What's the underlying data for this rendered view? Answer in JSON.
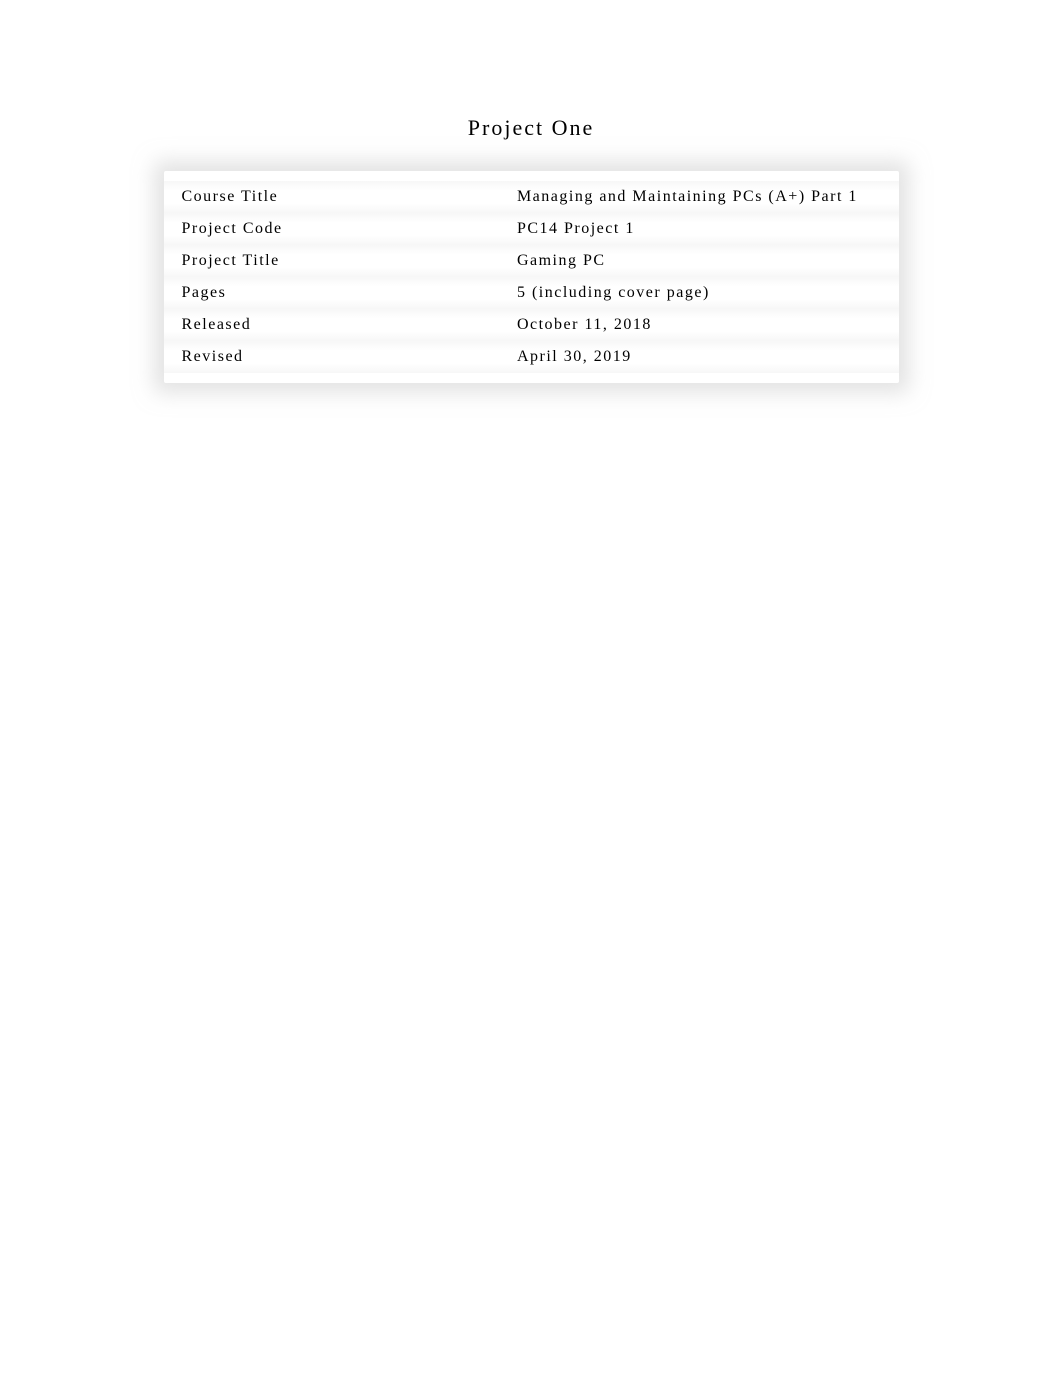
{
  "title": "Project One",
  "rows": [
    {
      "label": "Course Title",
      "value": "Managing and Maintaining PCs (A+) Part 1"
    },
    {
      "label": "Project Code",
      "value": "PC14 Project 1"
    },
    {
      "label": "Project Title",
      "value": "Gaming PC"
    },
    {
      "label": "Pages",
      "value": "5 (including cover page)"
    },
    {
      "label": "Released",
      "value": "October 11, 2018"
    },
    {
      "label": "Revised",
      "value": "April 30, 2019"
    }
  ]
}
